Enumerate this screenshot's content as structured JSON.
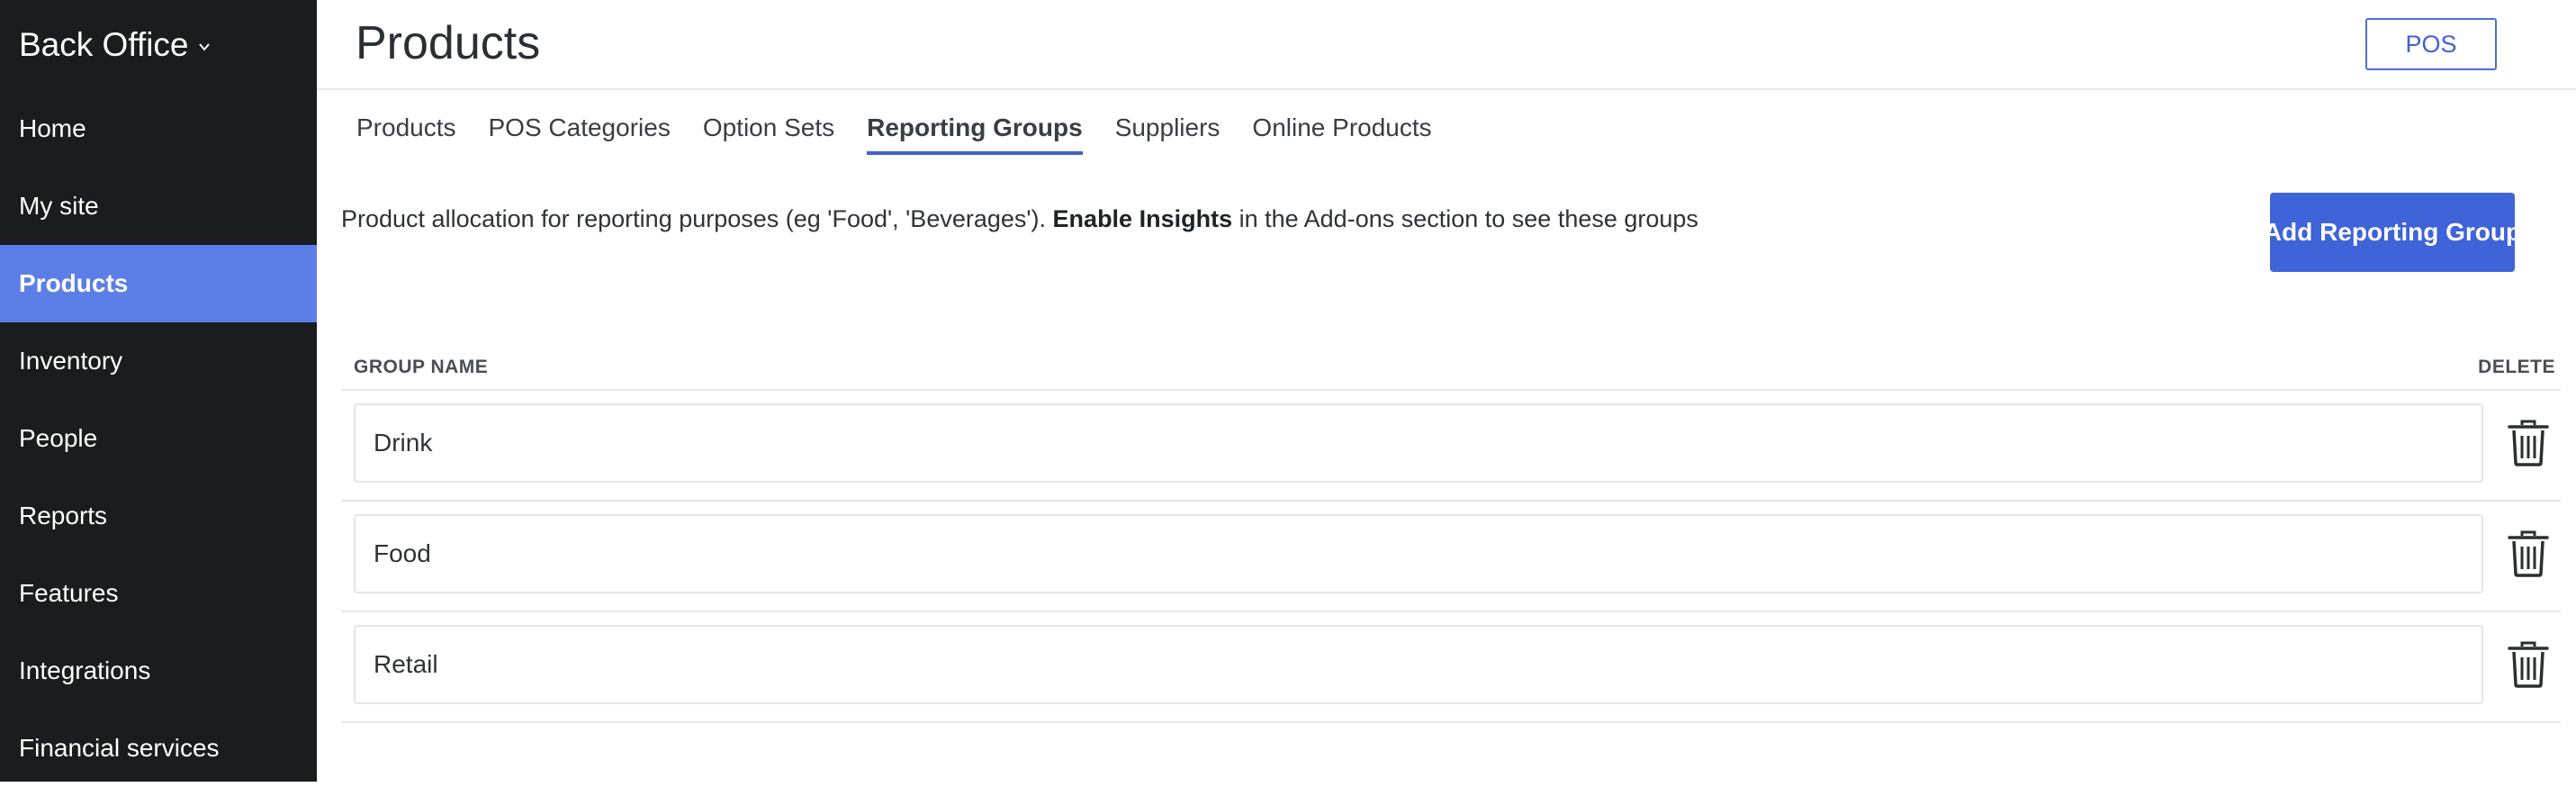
{
  "app": {
    "name": "Back Office"
  },
  "sidebar": {
    "items": [
      {
        "label": "Home"
      },
      {
        "label": "My site"
      },
      {
        "label": "Products",
        "active": true
      },
      {
        "label": "Inventory"
      },
      {
        "label": "People"
      },
      {
        "label": "Reports"
      },
      {
        "label": "Features"
      },
      {
        "label": "Integrations"
      },
      {
        "label": "Financial services"
      }
    ]
  },
  "header": {
    "title": "Products",
    "pos_label": "POS"
  },
  "tabs": [
    {
      "label": "Products"
    },
    {
      "label": "POS Categories"
    },
    {
      "label": "Option Sets"
    },
    {
      "label": "Reporting Groups",
      "active": true
    },
    {
      "label": "Suppliers"
    },
    {
      "label": "Online Products"
    }
  ],
  "description": {
    "before": "Product allocation for reporting purposes (eg 'Food', 'Beverages'). ",
    "bold": "Enable Insights",
    "after": " in the Add-ons section to see these groups"
  },
  "add_button": {
    "label": "Add Reporting Group"
  },
  "table": {
    "columns": {
      "name": "GROUP NAME",
      "delete": "DELETE"
    },
    "rows": [
      {
        "name": "Drink"
      },
      {
        "name": "Food"
      },
      {
        "name": "Retail"
      }
    ]
  },
  "colors": {
    "sidebar_bg": "#1a1c1f",
    "active_nav": "#5b7fe6",
    "primary": "#3f63d8",
    "border": "#e6e8eb"
  },
  "icons": {
    "brand_dropdown": "chevron-down-icon",
    "delete": "trash-icon"
  }
}
